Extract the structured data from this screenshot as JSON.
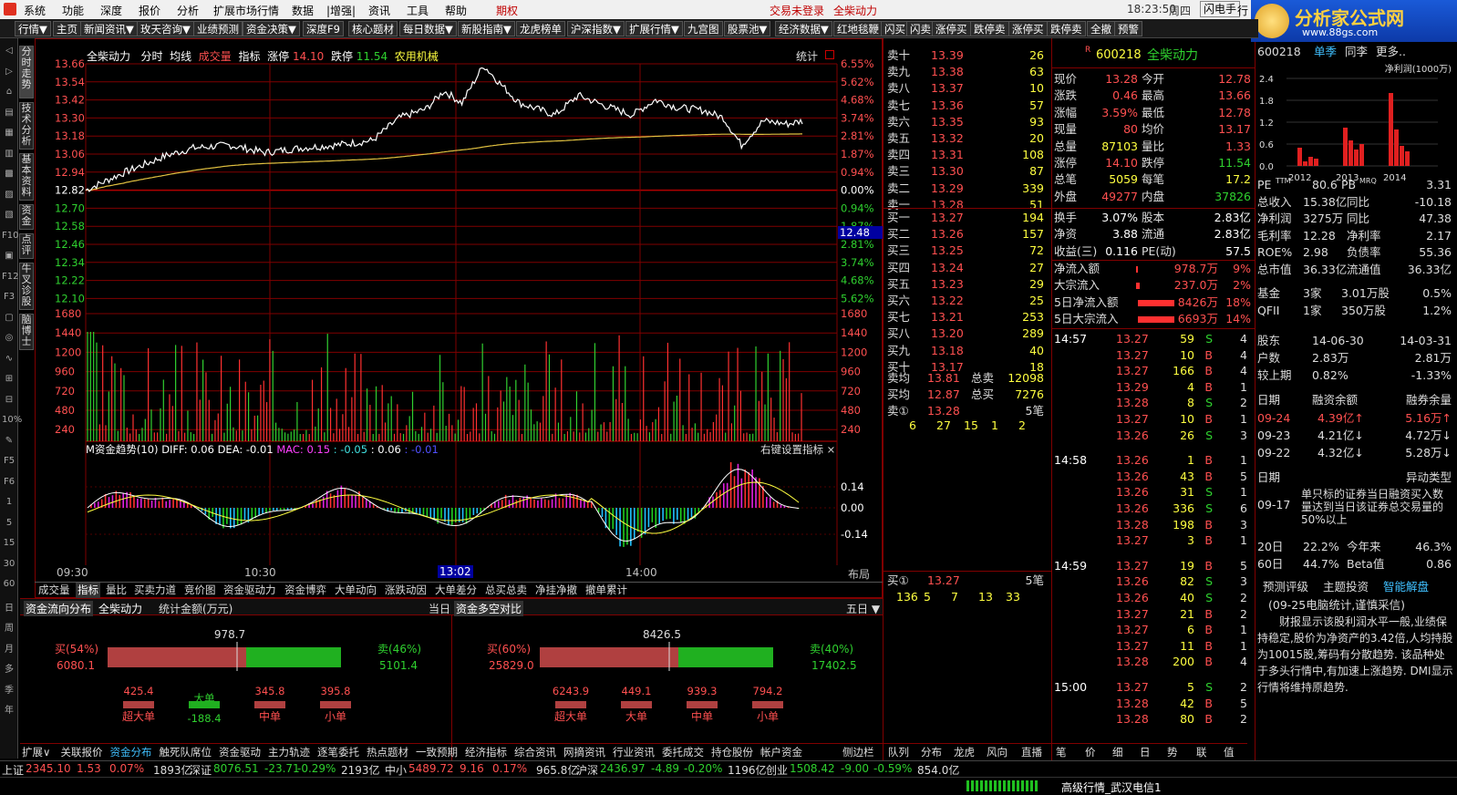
{
  "menu": {
    "items": [
      "系统",
      "功能",
      "深度",
      "报价",
      "分析",
      "扩展市场行情",
      "数据",
      "|增强|",
      "资讯",
      "工具",
      "帮助"
    ],
    "options": "期权",
    "login": "交易未登录",
    "stock_link": "全柴动力",
    "time": "18:23:50",
    "weekday": "周四",
    "flash": "闪电手",
    "more": "行"
  },
  "logo": {
    "text": "分析家公式网",
    "url": "www.88gs.com"
  },
  "toolbar": [
    "行情▼",
    "主页",
    "新闻资讯▼",
    "玫天咨询▼",
    "业绩预测",
    "资金决策▼",
    "深度F9",
    "核心题材",
    "每日数据▼",
    "新股指南▼",
    "龙虎榜单",
    "沪深指数▼",
    "扩展行情▼",
    "九宫图",
    "股票池▼",
    "经济数据▼",
    "红地毯鞭",
    "闪买",
    "闪卖",
    "涨停买",
    "跌停卖",
    "涨停买",
    "跌停卖",
    "全撤",
    "预警"
  ],
  "left_icons": [
    "◁",
    "▷",
    "⌂",
    "▤",
    "▦",
    "▥",
    "▩",
    "▨",
    "▧",
    "F10",
    "▣",
    "F12",
    "F3",
    "▢",
    "◎",
    "∿",
    "⊞",
    "⊟",
    "10%",
    "✎",
    "F5",
    "F6",
    "1",
    "5",
    "15",
    "30",
    "60",
    "日",
    "周",
    "月",
    "多",
    "季",
    "年"
  ],
  "vtabs": [
    "分时走势",
    "技术分析",
    "基本资料",
    "资金",
    "点评",
    "牛叉诊股",
    "脑博士"
  ],
  "chart": {
    "name": "全柴动力",
    "mode1": "分时",
    "mode2": "均线",
    "mode3": "成交量",
    "ind": "指标",
    "up_label": "涨停",
    "up_val": "14.10",
    "down_label": "跌停",
    "down_val": "11.54",
    "sector": "农用机械",
    "stat": "统计",
    "price_left": [
      "13.66",
      "13.54",
      "13.42",
      "13.30",
      "13.18",
      "13.06",
      "12.94",
      "12.82",
      "12.70",
      "12.58",
      "12.46",
      "12.34",
      "12.22",
      "12.10"
    ],
    "pct_right": [
      "6.55%",
      "5.62%",
      "4.68%",
      "3.74%",
      "2.81%",
      "1.87%",
      "0.94%",
      "0.00%",
      "0.94%",
      "1.87%",
      "2.81%",
      "3.74%",
      "4.68%",
      "5.62%"
    ],
    "cursor_price": "12.48",
    "vol_left": [
      "1680",
      "1440",
      "1200",
      "960",
      "720",
      "480",
      "240"
    ],
    "vol_right": [
      "1680",
      "1440",
      "1200",
      "960",
      "720",
      "480",
      "240"
    ],
    "macd_title": "M资金趋势(10)",
    "diff": "DIFF: 0.06",
    "dea": "DEA: -0.01",
    "mac": "MAC: 0.15",
    "mac2": ": -0.05",
    "mac3": ": 0.06",
    "mac4": ": -0.01",
    "rightset": "右键设置指标 ×",
    "macd_right": [
      "0.14",
      "0.00",
      "-0.14"
    ],
    "times": [
      "09:30",
      "10:30",
      "13:02",
      "14:00"
    ],
    "layout": "布局"
  },
  "chart_data": {
    "type": "line",
    "x": [
      "09:30",
      "10:30",
      "11:30/13:00",
      "14:00",
      "15:00"
    ],
    "series": [
      {
        "name": "",
        "values": [
          12.82,
          13.08,
          13.3,
          13.45,
          13.28
        ]
      }
    ],
    "ylim": [
      12.1,
      13.66
    ],
    "prev_close": 12.82
  },
  "bottom_tabs1": [
    "成交量",
    "指标",
    "量比",
    "买卖力道",
    "竞价图",
    "资金驱动力",
    "资金博弈",
    "大单动向",
    "涨跌动因",
    "大单差分",
    "总买总卖",
    "净挂净撤",
    "撤单累计"
  ],
  "flow": {
    "title": "资金流向分布",
    "name": "全柴动力",
    "unit": "统计金额(万元)",
    "day": "当日",
    "title2": "资金多空对比",
    "five": "五日 ▼",
    "left": {
      "total": "978.7",
      "buy_label": "买(54%)",
      "buy_val": "6080.1",
      "sell_label": "卖(46%)",
      "sell_val": "5101.4",
      "cats": [
        "超大单",
        "大单",
        "中单",
        "小单"
      ],
      "vals": [
        "425.4",
        "-188.4",
        "345.8",
        "395.8"
      ]
    },
    "right": {
      "total": "8426.5",
      "buy_label": "买(60%)",
      "buy_val": "25829.0",
      "sell_label": "卖(40%)",
      "sell_val": "17402.5",
      "cats": [
        "超大单",
        "大单",
        "中单",
        "小单"
      ],
      "vals": [
        "6243.9",
        "449.1",
        "939.3",
        "794.2"
      ]
    }
  },
  "orderbook": {
    "sells": [
      [
        "卖十",
        "13.39",
        "26"
      ],
      [
        "卖九",
        "13.38",
        "63"
      ],
      [
        "卖八",
        "13.37",
        "10"
      ],
      [
        "卖七",
        "13.36",
        "57"
      ],
      [
        "卖六",
        "13.35",
        "93"
      ],
      [
        "卖五",
        "13.32",
        "20"
      ],
      [
        "卖四",
        "13.31",
        "108"
      ],
      [
        "卖三",
        "13.30",
        "87"
      ],
      [
        "卖二",
        "13.29",
        "339"
      ],
      [
        "卖一",
        "13.28",
        "51"
      ]
    ],
    "buys": [
      [
        "买一",
        "13.27",
        "194"
      ],
      [
        "买二",
        "13.26",
        "157"
      ],
      [
        "买三",
        "13.25",
        "72"
      ],
      [
        "买四",
        "13.24",
        "27"
      ],
      [
        "买五",
        "13.23",
        "29"
      ],
      [
        "买六",
        "13.22",
        "25"
      ],
      [
        "买七",
        "13.21",
        "253"
      ],
      [
        "买八",
        "13.20",
        "289"
      ],
      [
        "买九",
        "13.18",
        "40"
      ],
      [
        "买十",
        "13.17",
        "18"
      ]
    ],
    "avg_sell_label": "卖均",
    "avg_sell": "13.81",
    "total_sell_label": "总卖",
    "total_sell": "12098",
    "avg_buy_label": "买均",
    "avg_buy": "12.87",
    "total_buy_label": "总买",
    "total_buy": "7276",
    "sell1_queue_label": "卖①",
    "sell1_queue_price": "13.28",
    "sell1_queue_count": "5笔",
    "sell1_queue": [
      "6",
      "27",
      "15",
      "1",
      "2"
    ],
    "buy1_queue_label": "买①",
    "buy1_queue_price": "13.27",
    "buy1_queue_count": "5笔",
    "buy1_queue": [
      "136",
      "5",
      "7",
      "13",
      "33"
    ]
  },
  "quote": {
    "code": "600218",
    "name": "全柴动力",
    "rows": [
      [
        "现价",
        "13.28",
        "今开",
        "12.78"
      ],
      [
        "涨跌",
        "0.46",
        "最高",
        "13.66"
      ],
      [
        "涨幅",
        "3.59%",
        "最低",
        "12.78"
      ],
      [
        "现量",
        "80",
        "均价",
        "13.17"
      ],
      [
        "总量",
        "87103",
        "量比",
        "1.33"
      ],
      [
        "涨停",
        "14.10",
        "跌停",
        "11.54"
      ],
      [
        "总笔",
        "5059",
        "每笔",
        "17.2"
      ],
      [
        "外盘",
        "49277",
        "内盘",
        "37826"
      ]
    ],
    "rows2": [
      [
        "换手",
        "3.07%",
        "股本",
        "2.83亿"
      ],
      [
        "净资",
        "3.88",
        "流通",
        "2.83亿"
      ],
      [
        "收益(三)",
        "0.116",
        "PE(动)",
        "57.5"
      ]
    ],
    "flow": [
      [
        "净流入额",
        "978.7万",
        "9%"
      ],
      [
        "大宗流入",
        "237.0万",
        "2%"
      ],
      [
        "5日净流入额",
        "8426万",
        "18%"
      ],
      [
        "5日大宗流入",
        "6693万",
        "14%"
      ]
    ]
  },
  "ticks": [
    [
      "14:57",
      "13.27",
      "59",
      "S",
      "4"
    ],
    [
      "",
      "13.27",
      "10",
      "B",
      "4"
    ],
    [
      "",
      "13.27",
      "166",
      "B",
      "4"
    ],
    [
      "",
      "13.29",
      "4",
      "B",
      "1"
    ],
    [
      "",
      "13.28",
      "8",
      "S",
      "2"
    ],
    [
      "",
      "13.27",
      "10",
      "B",
      "1"
    ],
    [
      "",
      "13.26",
      "26",
      "S",
      "3"
    ],
    [
      "14:58",
      "13.26",
      "1",
      "B",
      "1"
    ],
    [
      "",
      "13.26",
      "43",
      "B",
      "5"
    ],
    [
      "",
      "13.26",
      "31",
      "S",
      "1"
    ],
    [
      "",
      "13.26",
      "336",
      "S",
      "6"
    ],
    [
      "",
      "13.28",
      "198",
      "B",
      "3"
    ],
    [
      "",
      "13.27",
      "3",
      "B",
      "1"
    ],
    [
      "14:59",
      "13.27",
      "19",
      "B",
      "5"
    ],
    [
      "",
      "13.26",
      "82",
      "S",
      "3"
    ],
    [
      "",
      "13.26",
      "40",
      "S",
      "2"
    ],
    [
      "",
      "13.27",
      "21",
      "B",
      "2"
    ],
    [
      "",
      "13.27",
      "6",
      "B",
      "1"
    ],
    [
      "",
      "13.27",
      "11",
      "B",
      "1"
    ],
    [
      "",
      "13.28",
      "200",
      "B",
      "4"
    ],
    [
      "15:00",
      "13.27",
      "5",
      "S",
      "2"
    ],
    [
      "",
      "13.28",
      "42",
      "B",
      "5"
    ],
    [
      "",
      "13.28",
      "80",
      "B",
      "2"
    ]
  ],
  "f10": {
    "code": "600218",
    "tabs": [
      "单季",
      "同李",
      "更多.."
    ],
    "chart_label": "净利润(1000万)",
    "years": [
      "2012",
      "2013",
      "2014"
    ],
    "ylabels": [
      "2.4",
      "1.8",
      "1.2",
      "0.6",
      "0.0"
    ],
    "rows": [
      [
        "PE",
        "TTM",
        "80.6",
        "PB",
        "MRQ",
        "3.31"
      ],
      [
        "总收入",
        "15.38亿",
        "同比",
        "-10.18"
      ],
      [
        "净利润",
        "3275万",
        "同比",
        "47.38"
      ],
      [
        "毛利率",
        "12.28",
        "净利率",
        "2.17"
      ],
      [
        "ROE%",
        "2.98",
        "负债率",
        "55.36"
      ],
      [
        "总市值",
        "36.33亿",
        "流通值",
        "36.33亿"
      ]
    ],
    "fund": [
      [
        "基金",
        "3家",
        "3.01万股",
        "0.5%"
      ],
      [
        "QFII",
        "1家",
        "350万股",
        "1.2%"
      ]
    ],
    "holder": [
      [
        "股东",
        "14-06-30",
        "14-03-31"
      ],
      [
        "户数",
        "2.83万",
        "2.81万"
      ],
      [
        "较上期",
        "0.82%",
        "-1.33%"
      ]
    ],
    "margin_head": [
      "日期",
      "融资余额",
      "融券余量"
    ],
    "margin": [
      [
        "09-24",
        "4.39亿↑",
        "5.16万↑"
      ],
      [
        "09-23",
        "4.21亿↓",
        "4.72万↓"
      ],
      [
        "09-22",
        "4.32亿↓",
        "5.28万↓"
      ]
    ],
    "abn_head": [
      "日期",
      "异动类型"
    ],
    "abn_date": "09-17",
    "abn_text": "单只标的证券当日融资买入数量达到当日该证券总交易量的50%以上",
    "perf": [
      [
        "20日",
        "22.2%",
        "今年来",
        "46.3%"
      ],
      [
        "60日",
        "44.7%",
        "Beta值",
        "0.86"
      ]
    ],
    "eval_tabs": [
      "预测评级",
      "主题投资",
      "智能解盘"
    ],
    "eval_date": "(09-25电脑统计,谨慎采信)",
    "eval_text": "财报显示该股利润水平一般,业绩保持稳定,股价为净资产的3.42倍,人均持股为10015股,筹码有分散趋势.    该品种处于多头行情中,有加速上涨趋势.  DMI显示行情将维持原趋势."
  },
  "bottom_tabs2": [
    "扩展∨",
    "关联报价",
    "资金分布",
    "触死队席位",
    "资金驱动",
    "主力轨迹",
    "逐笔委托",
    "热点题材",
    "一致预期",
    "经济指标",
    "综合资讯",
    "网摘资讯",
    "行业资讯",
    "委托成交",
    "持仓股份",
    "帐户资金"
  ],
  "side_tabs": [
    "侧边栏",
    "队列",
    "分布",
    "龙虎",
    "风向",
    "直播",
    "笔",
    "价",
    "细",
    "日",
    "势",
    "联",
    "值",
    "主"
  ],
  "status": [
    [
      "上证",
      "2345.10",
      "1.53",
      "0.07%",
      "1893亿"
    ],
    [
      "深证",
      "8076.51",
      "-23.71",
      "-0.29%",
      "2193亿"
    ],
    [
      "中小",
      "5489.72",
      "9.16",
      "0.17%",
      "965.8亿"
    ],
    [
      "沪深",
      "2436.97",
      "-4.89",
      "-0.20%",
      "1196亿"
    ],
    [
      "创业",
      "1508.42",
      "-9.00",
      "-0.59%",
      "854.0亿"
    ]
  ],
  "status_right": "高级行情_武汉电信1"
}
